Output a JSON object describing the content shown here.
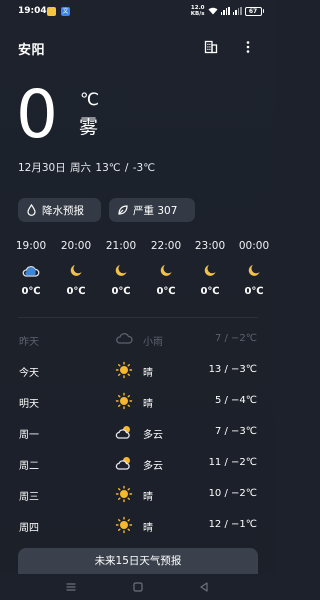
{
  "status": {
    "time": "19:04",
    "net_speed_top": "12.0",
    "net_speed_bottom": "KB/s",
    "battery": "67"
  },
  "header": {
    "city": "安阳"
  },
  "current": {
    "temp": "0",
    "unit": "℃",
    "condition": "雾",
    "date_line": "12月30日 周六  13℃ / -3℃"
  },
  "chips": {
    "rain_label": "降水预报",
    "air_label": "严重 307"
  },
  "hourly": [
    {
      "time": "19:00",
      "icon": "cloudy-night-icon",
      "temp": "0℃"
    },
    {
      "time": "20:00",
      "icon": "moon-icon",
      "temp": "0℃"
    },
    {
      "time": "21:00",
      "icon": "moon-icon",
      "temp": "0℃"
    },
    {
      "time": "22:00",
      "icon": "moon-icon",
      "temp": "0℃"
    },
    {
      "time": "23:00",
      "icon": "moon-icon",
      "temp": "0℃"
    },
    {
      "time": "00:00",
      "icon": "moon-icon",
      "temp": "0℃"
    }
  ],
  "daily": [
    {
      "day": "昨天",
      "icon": "cloud-rain-icon",
      "cond": "小雨",
      "range": "7 / −2℃",
      "past": true
    },
    {
      "day": "今天",
      "icon": "sun-icon",
      "cond": "晴",
      "range": "13 / −3℃",
      "past": false
    },
    {
      "day": "明天",
      "icon": "sun-icon",
      "cond": "晴",
      "range": "5 / −4℃",
      "past": false
    },
    {
      "day": "周一",
      "icon": "partly-cloudy-icon",
      "cond": "多云",
      "range": "7 / −3℃",
      "past": false
    },
    {
      "day": "周二",
      "icon": "partly-cloudy-icon",
      "cond": "多云",
      "range": "11 / −2℃",
      "past": false
    },
    {
      "day": "周三",
      "icon": "sun-icon",
      "cond": "晴",
      "range": "10 / −2℃",
      "past": false
    },
    {
      "day": "周四",
      "icon": "sun-icon",
      "cond": "晴",
      "range": "12 / −1℃",
      "past": false
    }
  ],
  "footer": {
    "forecast_15": "未来15日天气预报"
  },
  "colors": {
    "background": "#1c212b",
    "chip": "#343a45",
    "sun": "#f5b82e",
    "moon": "#f2c14a",
    "muted": "#5d636e"
  }
}
